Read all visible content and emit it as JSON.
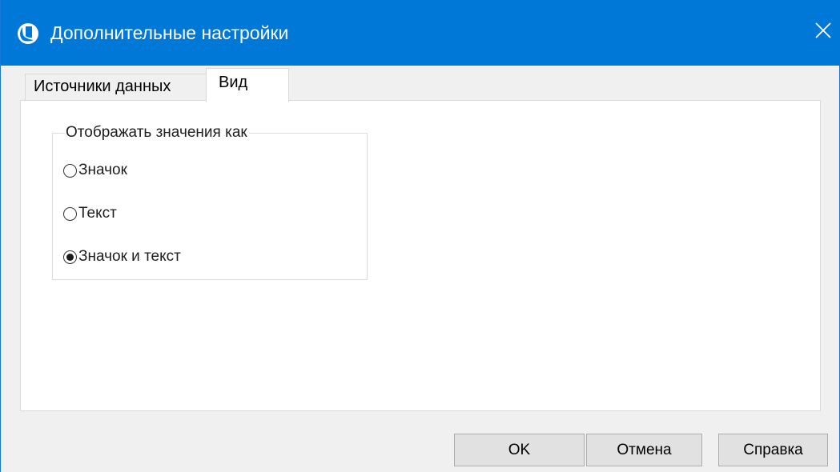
{
  "window": {
    "title": "Дополнительные настройки",
    "app_icon": "app-logo-icon",
    "close_icon": "close-icon"
  },
  "tabs": [
    {
      "label": "Источники данных",
      "active": false
    },
    {
      "label": "Вид",
      "active": true
    }
  ],
  "display_group": {
    "legend": "Отображать значения как",
    "options": [
      {
        "label": "Значок",
        "selected": false
      },
      {
        "label": "Текст",
        "selected": false
      },
      {
        "label": "Значок и текст",
        "selected": true
      }
    ]
  },
  "buttons": {
    "ok_label": "OK",
    "cancel_label": "Отмена",
    "help_label": "Справка"
  },
  "colors": {
    "titlebar": "#0078d7",
    "window_bg": "#f0f0f0",
    "panel_bg": "#ffffff",
    "button_bg": "#e1e1e1"
  }
}
